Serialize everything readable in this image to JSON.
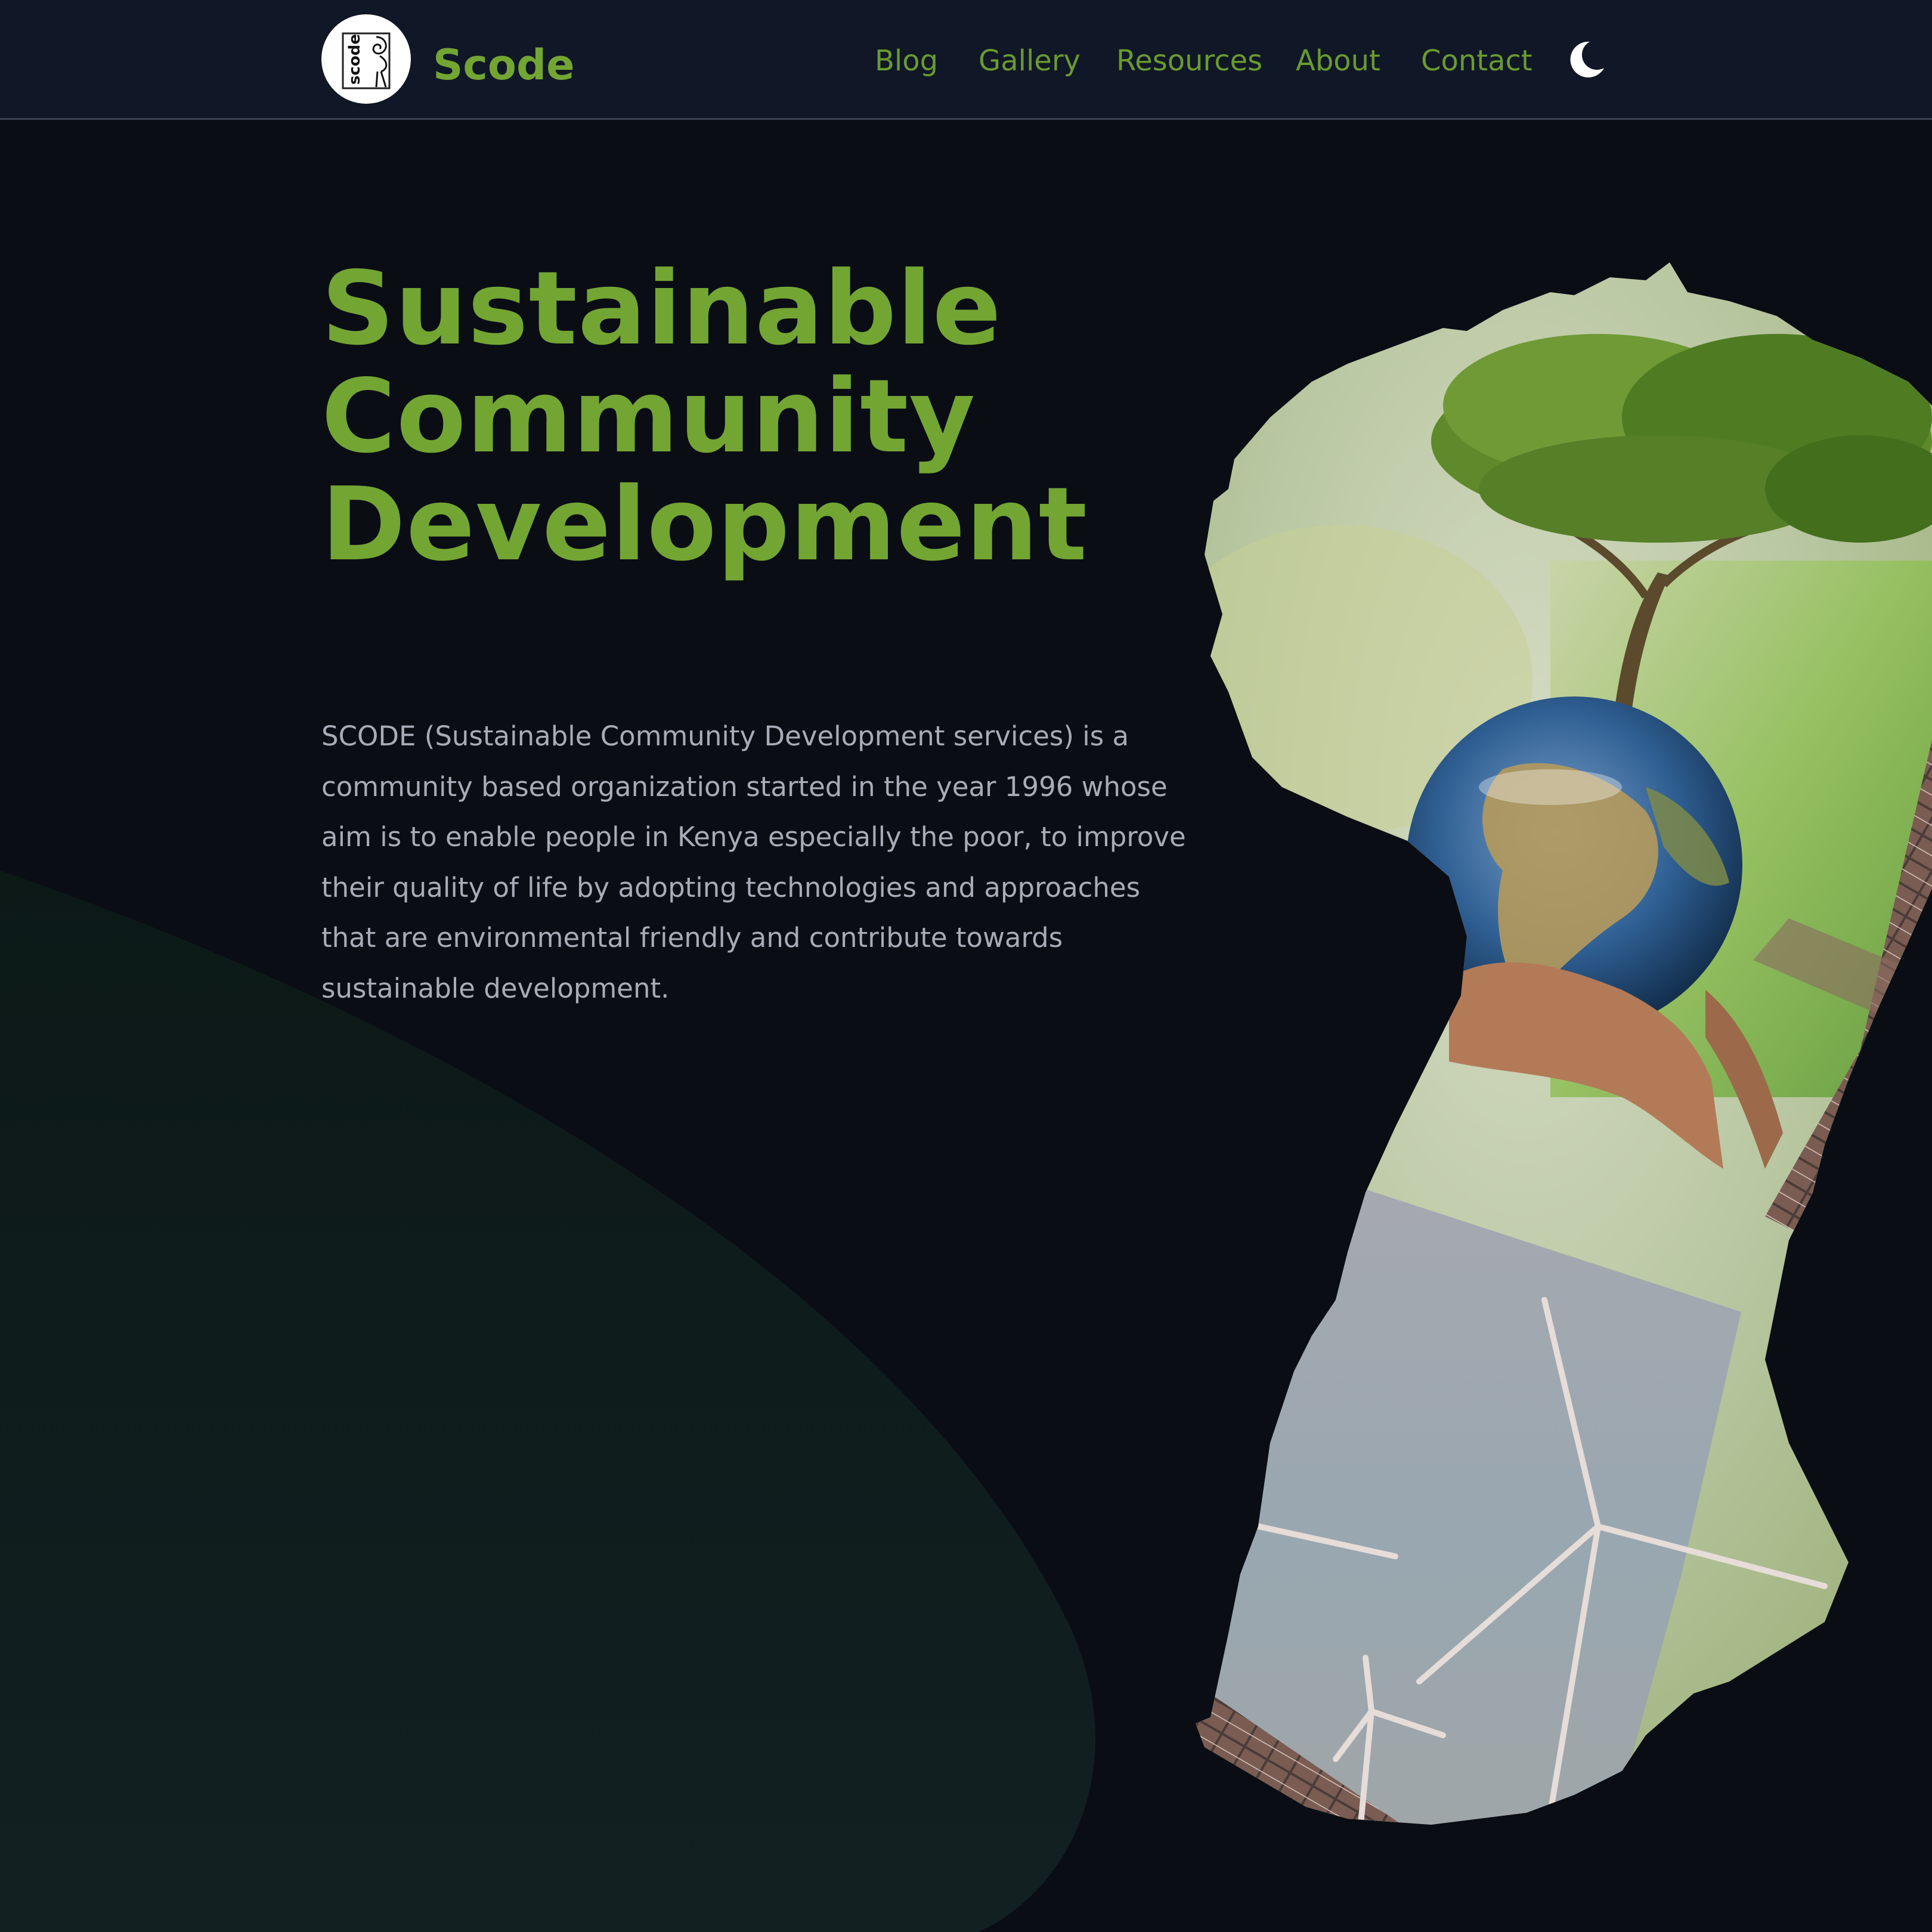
{
  "header": {
    "brand": "Scode",
    "logo_text": "scode",
    "logo_icon": "scode-logo-icon",
    "nav": [
      {
        "label": "Blog"
      },
      {
        "label": "Gallery"
      },
      {
        "label": "Resources"
      },
      {
        "label": "About"
      },
      {
        "label": "Contact"
      }
    ],
    "theme_toggle_icon": "moon-icon"
  },
  "hero": {
    "title_lines": [
      "Sustainable",
      "Community",
      "Development"
    ],
    "description": "SCODE (Sustainable Community Development services) is a community based organization started in the year 1996 whose aim is to enable people in Kenya especially the poor, to improve their quality of life by adopting technologies and approaches that are environmental friendly and contribute towards sustainable development."
  },
  "colors": {
    "background": "#0a0d14",
    "header_background": "#101726",
    "accent": "#73a533",
    "nav_link": "#6a9a2e",
    "body_text": "#a7acb6"
  }
}
